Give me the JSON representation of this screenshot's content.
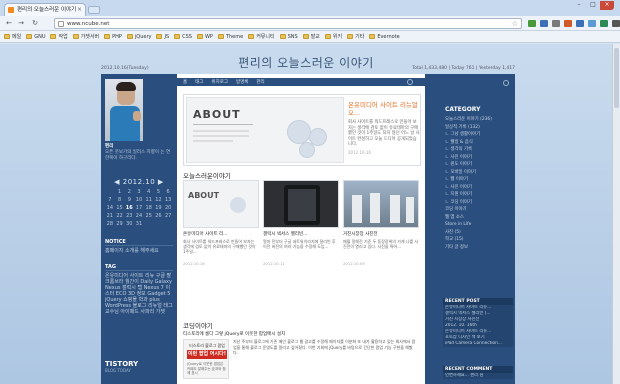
{
  "browser": {
    "tab_title": "편리의 오늘스러운 이야기",
    "url": "www.ncube.net",
    "bookmarks": [
      "메일",
      "GNU",
      "작업",
      "가젯서버",
      "PHP",
      "jQuery",
      "JS",
      "CSS",
      "WP",
      "Theme",
      "커뮤니티",
      "SNS",
      "발교",
      "위키",
      "기타",
      "Evernote"
    ]
  },
  "site": {
    "title": "편리의 오늘스러운 이야기",
    "date": "2012.10.16(Tuesday)",
    "stats": "Total 1,433,480 | Today 761 | Yesterday 1,417"
  },
  "left": {
    "intro_head": "편리",
    "intro_text": "오픈 웃보기의 일러스 지향이 는 연 한복이 하구리다.",
    "calendar_title": "◀ 2012.10 ▶",
    "calendar_days": [
      "",
      "",
      "",
      "",
      "",
      "",
      "",
      "",
      "",
      "",
      "",
      "",
      "",
      "",
      "",
      "",
      "",
      "",
      "",
      "",
      "",
      "",
      "",
      "",
      "",
      "",
      ""
    ],
    "cal": [
      "1",
      "2",
      "3",
      "4",
      "5",
      "6",
      "7",
      "8",
      "9",
      "10",
      "11",
      "12",
      "13",
      "14",
      "15",
      "16",
      "17",
      "18",
      "19",
      "20",
      "21",
      "22",
      "23",
      "24",
      "25",
      "26",
      "27",
      "28",
      "29",
      "30",
      "31"
    ],
    "notice_title": "NOTICE",
    "notice_item": "홈페이지 소개를 해주세요",
    "tag_title": "TAG",
    "tags": "온유미디어 사이트 리뉴 구글 팔 크롬브라 월간이 Daily Galaxy Nexus 갤럭시 탭 Nexus 7 이스터 ECO 3D 정보 Gadget 5 jQuery 쇼핑몰 학과 plus WordPress 블로그 리뉴얼 태그 교수님 아이패드 사파리 가젯",
    "tistory": "TISTORY",
    "tistory_sub": "BLOG TODAY"
  },
  "menu": [
    "홈",
    "태그",
    "위치로그",
    "방명록",
    "관리"
  ],
  "featured": {
    "title": "온유미디어 사이트 리뉴얼 오...",
    "body": "회사 사이트를 워드프레스로 만들어 보자는 생각에 검토 없이 유료테마의 구매했던 것이 1주일도 되지 않던 어느 날 사이트 완성하고 오늘 드디어 공개되었습니다.",
    "date": "2012.10.16",
    "image_label": "ABOUT"
  },
  "section_title": "오늘스러운이야기",
  "cards": [
    {
      "title": "온유미디어 사이트 리...",
      "body": "회사 사이트를 워드프레스로 만들어 보자는 생각에 검토 없이 유료테마의 구매했던 것이 1주일...",
      "date": "2012.10.16",
      "img": "ABOUT"
    },
    {
      "title": "갤럭시 넥서스 젤리빈...",
      "body": "얼마 전부터 구글 네트워이라지에 잘리빈 후 이전 버전의 여러 기능을 수정해 도입...",
      "date": "2012.10.11",
      "img": ""
    },
    {
      "title": "거진시장장 사진전",
      "body": "매월 정해진 기준 두 동장장위의 가게 나를 사진전이 열리고 있다. 사진을 찍어...",
      "date": "2012.10.09",
      "img": ""
    }
  ],
  "cody": {
    "header": "코딩이야기",
    "post_title": "티스토리에 롱다 그렇 jQuery로 이웃한 팝업메시 설치",
    "banner_top": "티스토리 블로그 팝업",
    "banner_main": "이런 팝업 어시다!",
    "banner_sub": "jQuery로 이웃한 팝업은 카페도 말해주는 효과와 함께 표시",
    "body": "지난 주부터 블로그에 기존 메인 블로그 웹 광고를 수정해 페이지를 이분화 또 내가 활용하고 있는 회사에서 팝업을 통해 블로그 운영도를 알리고 싶어졌다. 이번 기회에 jQuery를 바탕으로 간단한 팝업 기능 구현을 해봤다."
  },
  "right": {
    "category_title": "CATEGORY",
    "categories": [
      "오늘스러운 이야기 (236)",
      "일상적 기록 (132)",
      "ㄴ 그냥 생활이야기",
      "ㄴ 웰빙 & 음식",
      "ㄴ 생각의 기록",
      "ㄴ 사진 이야기",
      "ㄴ 윈도 이야기",
      "ㄴ 모바일 이야기",
      "ㄴ 웹 이야기",
      "ㄴ 사진 이야기",
      "ㄴ 지원 이야기",
      "ㄴ 코딩 이야기",
      "코딩 이야기",
      "웹 앱 소스",
      "Store in Life",
      "사진 (5)",
      "학교 (15)",
      "기타 글 정보"
    ],
    "recent_post_title": "RECENT POST",
    "recent_posts": [
      "온유미디어 사이트 리뉴...",
      "갤럭시 넥서스 젤리빈 (...",
      "거진 시장장 사진전",
      "2012. 10. 16th",
      "온유미디어 사이트 리뉴...",
      "포토샵 디자인 책 보기",
      "iPad Camera Connection..."
    ],
    "recent_comment_title": "RECENT COMMENT",
    "recent_comments": [
      "언변하세요...  편리 님"
    ]
  }
}
